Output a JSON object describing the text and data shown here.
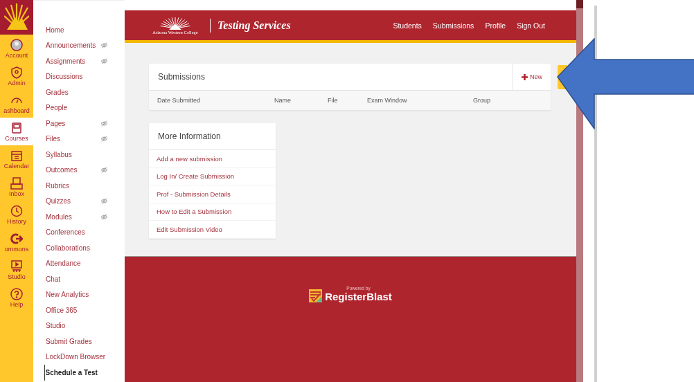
{
  "global_nav": [
    {
      "label": "Account",
      "selected": false
    },
    {
      "label": "Admin",
      "selected": false
    },
    {
      "label": "ashboard",
      "selected": false
    },
    {
      "label": "Courses",
      "selected": true
    },
    {
      "label": "Calendar",
      "selected": false
    },
    {
      "label": "Inbox",
      "selected": false
    },
    {
      "label": "History",
      "selected": false
    },
    {
      "label": "ommons",
      "selected": false
    },
    {
      "label": "Studio",
      "selected": false
    },
    {
      "label": "Help",
      "selected": false
    }
  ],
  "course_nav": [
    {
      "label": "Home",
      "hidden": false,
      "selected": false
    },
    {
      "label": "Announcements",
      "hidden": true,
      "selected": false
    },
    {
      "label": "Assignments",
      "hidden": true,
      "selected": false
    },
    {
      "label": "Discussions",
      "hidden": false,
      "selected": false
    },
    {
      "label": "Grades",
      "hidden": false,
      "selected": false
    },
    {
      "label": "People",
      "hidden": false,
      "selected": false
    },
    {
      "label": "Pages",
      "hidden": true,
      "selected": false
    },
    {
      "label": "Files",
      "hidden": true,
      "selected": false
    },
    {
      "label": "Syllabus",
      "hidden": false,
      "selected": false
    },
    {
      "label": "Outcomes",
      "hidden": true,
      "selected": false
    },
    {
      "label": "Rubrics",
      "hidden": false,
      "selected": false
    },
    {
      "label": "Quizzes",
      "hidden": true,
      "selected": false
    },
    {
      "label": "Modules",
      "hidden": true,
      "selected": false
    },
    {
      "label": "Conferences",
      "hidden": false,
      "selected": false
    },
    {
      "label": "Collaborations",
      "hidden": false,
      "selected": false
    },
    {
      "label": "Attendance",
      "hidden": false,
      "selected": false
    },
    {
      "label": "Chat",
      "hidden": false,
      "selected": false
    },
    {
      "label": "New Analytics",
      "hidden": false,
      "selected": false
    },
    {
      "label": "Office 365",
      "hidden": false,
      "selected": false
    },
    {
      "label": "Studio",
      "hidden": false,
      "selected": false
    },
    {
      "label": "Submit Grades",
      "hidden": false,
      "selected": false
    },
    {
      "label": "LockDown Browser",
      "hidden": false,
      "selected": false
    },
    {
      "label": "Schedule a Test",
      "hidden": false,
      "selected": true
    }
  ],
  "header": {
    "logo_caption": "Arizona Western College",
    "title": "Testing Services",
    "links": [
      "Students",
      "Submissions",
      "Profile",
      "Sign Out"
    ]
  },
  "submissions": {
    "title": "Submissions",
    "new_button": "New",
    "table": {
      "columns": [
        "Date Submitted",
        "Name",
        "File",
        "Exam Window",
        "Group"
      ]
    }
  },
  "more_information": {
    "title": "More Information",
    "links": [
      "Add a new submission",
      "Log In/ Create Submission",
      "Prof - Submission Details",
      "How to Edit a Submission",
      "Edit Submission Video"
    ]
  },
  "footer": {
    "powered_by": "Powered by",
    "brand": "RegisterBlast"
  }
}
